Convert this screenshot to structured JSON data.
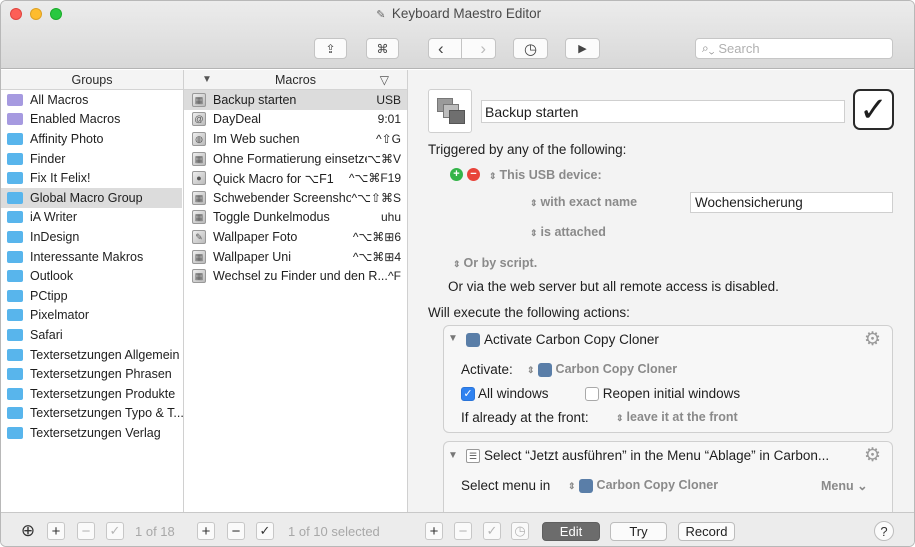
{
  "window": {
    "title": "Keyboard Maestro Editor"
  },
  "toolbar": {
    "search_placeholder": "Search",
    "cmd_glyph": "⌘",
    "share_glyph": "⇪",
    "back_glyph": "‹",
    "forward_glyph": "›",
    "clock_glyph": "◷",
    "play_glyph": "▶"
  },
  "groups": {
    "header": "Groups",
    "items": [
      {
        "label": "All Macros",
        "smart": true
      },
      {
        "label": "Enabled Macros",
        "smart": true
      },
      {
        "label": "Affinity Photo"
      },
      {
        "label": "Finder"
      },
      {
        "label": "Fix It Felix!"
      },
      {
        "label": "Global Macro Group",
        "selected": true
      },
      {
        "label": "iA Writer"
      },
      {
        "label": "InDesign"
      },
      {
        "label": "Interessante Makros"
      },
      {
        "label": "Outlook"
      },
      {
        "label": "PCtipp"
      },
      {
        "label": "Pixelmator"
      },
      {
        "label": "Safari"
      },
      {
        "label": "Textersetzungen Allgemein"
      },
      {
        "label": "Textersetzungen Phrasen"
      },
      {
        "label": "Textersetzungen Produkte"
      },
      {
        "label": "Textersetzungen Typo & T..."
      },
      {
        "label": "Textersetzungen Verlag"
      }
    ]
  },
  "macros": {
    "header": "Macros",
    "items": [
      {
        "name": "Backup starten",
        "trigger": "USB",
        "selected": true
      },
      {
        "name": "DayDeal",
        "trigger": "9:01"
      },
      {
        "name": "Im Web suchen",
        "trigger": "^⇧G"
      },
      {
        "name": "Ohne Formatierung einsetzen",
        "trigger": "⌥⌘V"
      },
      {
        "name": "Quick Macro for ⌥F1",
        "trigger": "^⌥⌘F19"
      },
      {
        "name": "Schwebender Screenshot",
        "trigger": "^⌥⇧⌘S"
      },
      {
        "name": "Toggle Dunkelmodus",
        "trigger": "uhu"
      },
      {
        "name": "Wallpaper Foto",
        "trigger": "^⌥⌘⊞6"
      },
      {
        "name": "Wallpaper Uni",
        "trigger": "^⌥⌘⊞4"
      },
      {
        "name": "Wechsel zu Finder und den R...",
        "trigger": "^F"
      }
    ]
  },
  "detail": {
    "macro_name": "Backup starten",
    "triggered_by": "Triggered by any of the following:",
    "usb_trigger": "This USB device:",
    "with_exact_name": "with exact name",
    "device_name": "Wochensicherung",
    "is_attached": "is attached",
    "or_by_script": "Or by script.",
    "web_server_note": "Or via the web server but all remote access is disabled.",
    "will_execute": "Will execute the following actions:",
    "action1": {
      "title": "Activate Carbon Copy Cloner",
      "activate_label": "Activate:",
      "app": "Carbon Copy Cloner",
      "all_windows": "All windows",
      "reopen": "Reopen initial windows",
      "front_label": "If already at the front:",
      "front_value": "leave it at the front"
    },
    "action2": {
      "title": "Select “Jetzt ausführen” in the Menu “Ablage” in Carbon...",
      "menu_label": "Select menu in",
      "app": "Carbon Copy Cloner",
      "menu_dropdown": "Menu"
    }
  },
  "bottom": {
    "groups_count": "1 of 18",
    "macros_count": "1 of 10 selected",
    "edit": "Edit",
    "try": "Try",
    "record": "Record",
    "help": "?"
  }
}
